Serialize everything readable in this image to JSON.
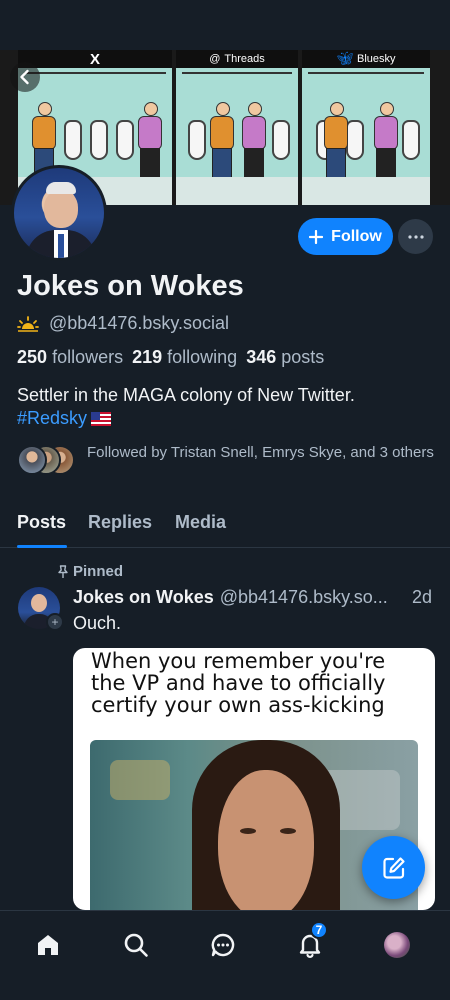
{
  "banner": {
    "panels": [
      "X",
      "Threads",
      "Bluesky"
    ]
  },
  "profile": {
    "display_name": "Jokes on Wokes",
    "handle": "@bb41476.bsky.social",
    "followers_count": "250",
    "followers_label": "followers",
    "following_count": "219",
    "following_label": "following",
    "posts_count": "346",
    "posts_label": "posts",
    "bio_text": "Settler in the MAGA colony of New Twitter.",
    "bio_hashtag": "#Redsky",
    "followed_by": "Followed by Tristan Snell, Emrys Skye, and 3 others"
  },
  "actions": {
    "follow_label": "Follow"
  },
  "tabs": [
    {
      "label": "Posts"
    },
    {
      "label": "Replies"
    },
    {
      "label": "Media"
    }
  ],
  "post": {
    "pinned_label": "Pinned",
    "author_name": "Jokes on Wokes",
    "author_handle": "@bb41476.bsky.so...",
    "time": "2d",
    "text": "Ouch.",
    "image_caption": "When you remember you're the VP and have to officially certify your own ass-kicking"
  },
  "nav": {
    "notifications_badge": "7"
  },
  "colors": {
    "background": "#161e27",
    "accent": "#1083fe",
    "muted_text": "#aebbc9"
  }
}
